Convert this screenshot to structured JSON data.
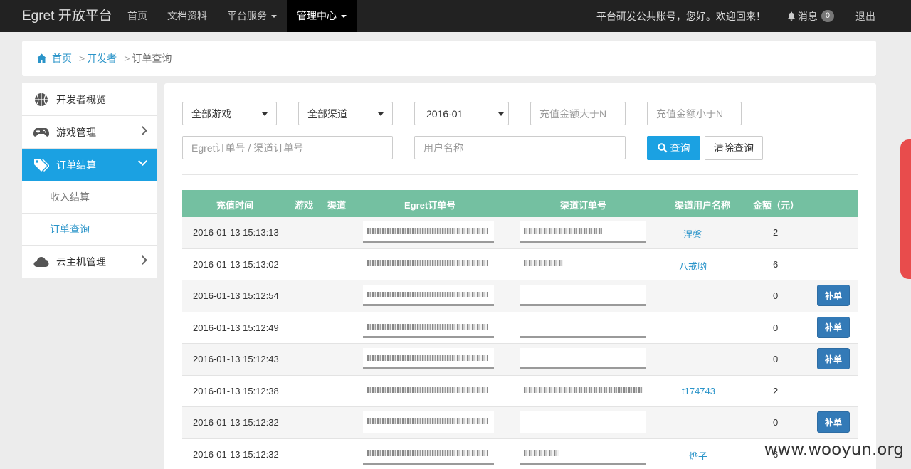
{
  "navbar": {
    "brand": "Egret 开放平台",
    "items": [
      {
        "label": "首页",
        "dropdown": false,
        "active": false
      },
      {
        "label": "文档资料",
        "dropdown": false,
        "active": false
      },
      {
        "label": "平台服务",
        "dropdown": true,
        "active": false
      },
      {
        "label": "管理中心",
        "dropdown": true,
        "active": true
      }
    ],
    "greeting": "平台研发公共账号，您好。欢迎回来！",
    "messages_label": "消息",
    "messages_count": "0",
    "logout": "退出"
  },
  "breadcrumb": {
    "home": "首页",
    "developer": "开发者",
    "current": "订单查询",
    "sep": ">"
  },
  "sidebar": {
    "items": [
      {
        "label": "开发者概览",
        "icon": "basketball-icon"
      },
      {
        "label": "游戏管理",
        "icon": "gamepad-icon"
      },
      {
        "label": "订单结算",
        "icon": "tags-icon"
      },
      {
        "label": "云主机管理",
        "icon": "cloud-icon"
      }
    ],
    "sub_items": [
      "收入结算",
      "订单查询"
    ]
  },
  "filters": {
    "game_select": "全部游戏",
    "channel_select": "全部渠道",
    "month_select": "2016-01",
    "amount_min_placeholder": "充值金额大于N",
    "amount_max_placeholder": "充值金额小于N",
    "order_placeholder": "Egret订单号 / 渠道订单号",
    "user_placeholder": "用户名称",
    "search_button": "查询",
    "clear_button": "清除查询"
  },
  "table": {
    "headers": [
      "充值时间",
      "游戏",
      "渠道",
      "Egret订单号",
      "渠道订单号",
      "渠道用户名称",
      "金额（元）"
    ],
    "fill_button": "补单",
    "rows": [
      {
        "time": "2016-01-13 15:13:13",
        "user": "涅槃",
        "amount": "2",
        "fill": false
      },
      {
        "time": "2016-01-13 15:13:02",
        "user": "八戒哟",
        "amount": "6",
        "fill": false
      },
      {
        "time": "2016-01-13 15:12:54",
        "user": "",
        "amount": "0",
        "fill": true
      },
      {
        "time": "2016-01-13 15:12:49",
        "user": "",
        "amount": "0",
        "fill": true
      },
      {
        "time": "2016-01-13 15:12:43",
        "user": "",
        "amount": "0",
        "fill": true
      },
      {
        "time": "2016-01-13 15:12:38",
        "user": "t174743",
        "amount": "2",
        "fill": false
      },
      {
        "time": "2016-01-13 15:12:32",
        "user": "",
        "amount": "0",
        "fill": true
      },
      {
        "time": "2016-01-13 15:12:32",
        "user": "烨子",
        "amount": "6",
        "fill": false
      }
    ]
  },
  "watermark": "www.wooyun.org",
  "colors": {
    "navbar_bg": "#222222",
    "accent": "#1ba1e2",
    "table_header": "#74c0a1",
    "fill_button": "#337ab7",
    "float_tab": "#e84c4c"
  }
}
